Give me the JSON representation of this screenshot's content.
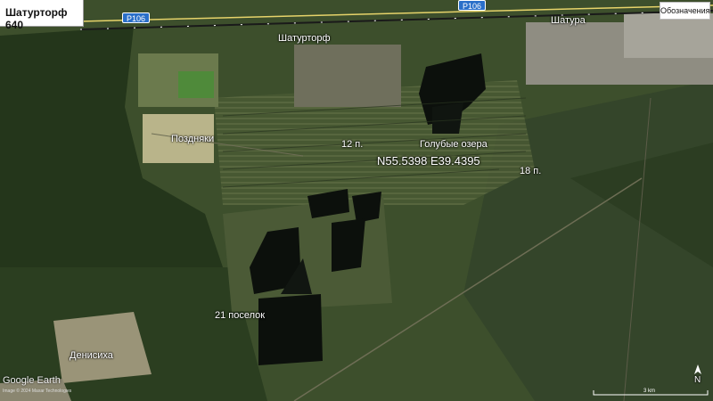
{
  "window": {
    "title": "Шатурторф 640"
  },
  "toolbar": {
    "legend_label": "Обозначения"
  },
  "roads": [
    {
      "label": "P106"
    },
    {
      "label": "P106"
    }
  ],
  "places": [
    {
      "name": "Шатурторф"
    },
    {
      "name": "Шатура"
    },
    {
      "name": "Поздняки"
    },
    {
      "name": "12 п."
    },
    {
      "name": "Голубые озера"
    },
    {
      "name": "18 п."
    },
    {
      "name": "21 поселок"
    },
    {
      "name": "Денисиха"
    }
  ],
  "marker": {
    "coordinates": "N55.5398 E39.4395",
    "icon": "pushpin-icon",
    "color": "#ffd700"
  },
  "attribution": {
    "logo": "Google Earth",
    "credit": "Image © 2024 Maxar Technologies"
  },
  "scale": {
    "label": "3 km"
  },
  "compass": {
    "label": "N"
  },
  "colors": {
    "terrain": "#3d4f2c",
    "forest": "#25361c",
    "water": "#0c100c",
    "road": "#2a6fc9",
    "railway": "#1a1a1a"
  }
}
